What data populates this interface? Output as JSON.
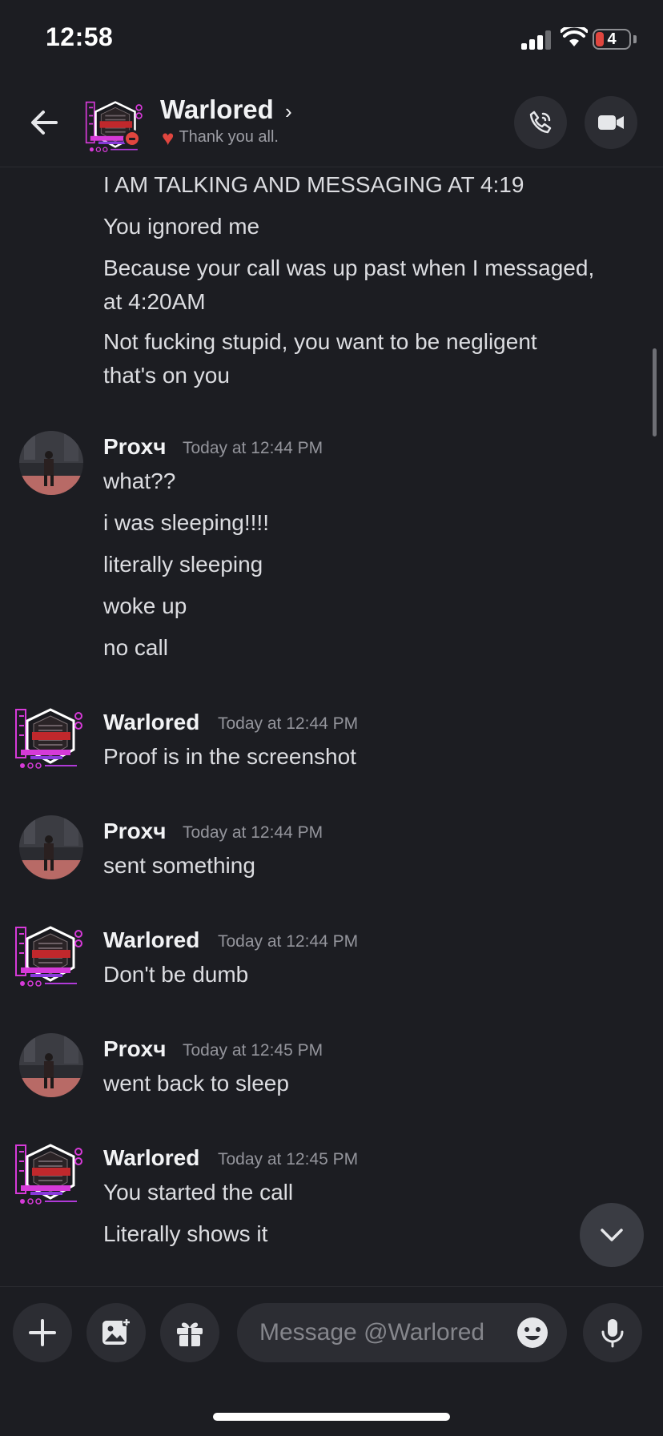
{
  "status_bar": {
    "time": "12:58",
    "battery": "4"
  },
  "header": {
    "channel_name": "Warlored",
    "status_text": "Thank you all.",
    "icons": {
      "back": "arrow-left-icon",
      "call": "phone-icon",
      "video": "video-camera-icon",
      "status_emoji": "red-heart-icon"
    }
  },
  "messages": {
    "continued": [
      "I AM TALKING AND MESSAGING AT 4:19",
      "You ignored me",
      "Because your call was up past when I messaged,",
      "at 4:20AM",
      "Not fucking stupid, you want to be negligent",
      "that's on you"
    ],
    "groups": [
      {
        "author": "Proxч",
        "timestamp": "Today at 12:44 PM",
        "lines": [
          "what??",
          "i was sleeping!!!!",
          "literally sleeping",
          "woke up",
          "no call"
        ]
      },
      {
        "author": "Warlored",
        "timestamp": "Today at 12:44 PM",
        "lines": [
          "Proof is in the screenshot"
        ]
      },
      {
        "author": "Proxч",
        "timestamp": "Today at 12:44 PM",
        "lines": [
          "sent something"
        ]
      },
      {
        "author": "Warlored",
        "timestamp": "Today at 12:44 PM",
        "lines": [
          "Don't be dumb"
        ]
      },
      {
        "author": "Proxч",
        "timestamp": "Today at 12:45 PM",
        "lines": [
          "went back to sleep"
        ]
      },
      {
        "author": "Warlored",
        "timestamp": "Today at 12:45 PM",
        "lines": [
          "You started the call",
          "Literally shows it"
        ]
      }
    ]
  },
  "composer": {
    "placeholder": "Message @Warlored",
    "icons": {
      "add": "plus-icon",
      "image": "image-icon",
      "gift": "gift-icon",
      "emoji": "emoji-icon",
      "mic": "microphone-icon"
    }
  },
  "colors": {
    "background": "#1c1d22",
    "surface": "#2c2d33",
    "text": "#dcdde1",
    "muted": "#94959c",
    "dnd": "#e0463f",
    "logo_accent": "#d63ad8"
  }
}
